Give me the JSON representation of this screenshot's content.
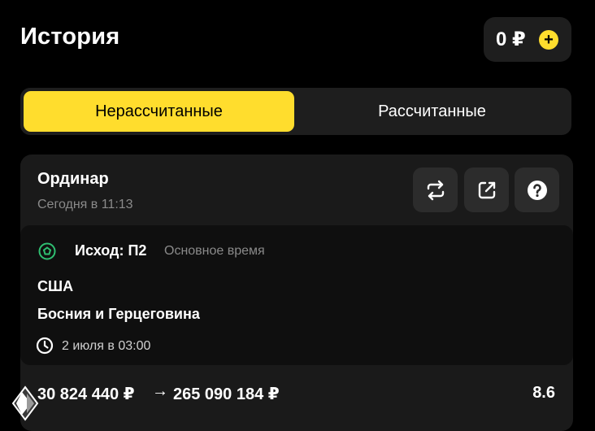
{
  "header": {
    "title": "История",
    "balance": "0 ₽",
    "add_label": "+"
  },
  "tabs": [
    {
      "label": "Нерассчитанные",
      "active": true
    },
    {
      "label": "Рассчитанные",
      "active": false
    }
  ],
  "bet": {
    "type": "Ординар",
    "date": "Сегодня в 11:13",
    "event": {
      "sport_icon": "soccer-ball-icon",
      "outcome": "Исход: П2",
      "period": "Основное время",
      "team1": "США",
      "team2": "Босния и Герцеговина",
      "time": "2 июля в 03:00"
    },
    "stake": "30 824 440 ₽",
    "arrow": "→",
    "payout": "265 090 184 ₽",
    "odds": "8.6"
  },
  "colors": {
    "accent": "#ffdd2d",
    "background": "#000000",
    "surface": "#1a1a1a",
    "soccer_icon": "#2fbf71"
  }
}
